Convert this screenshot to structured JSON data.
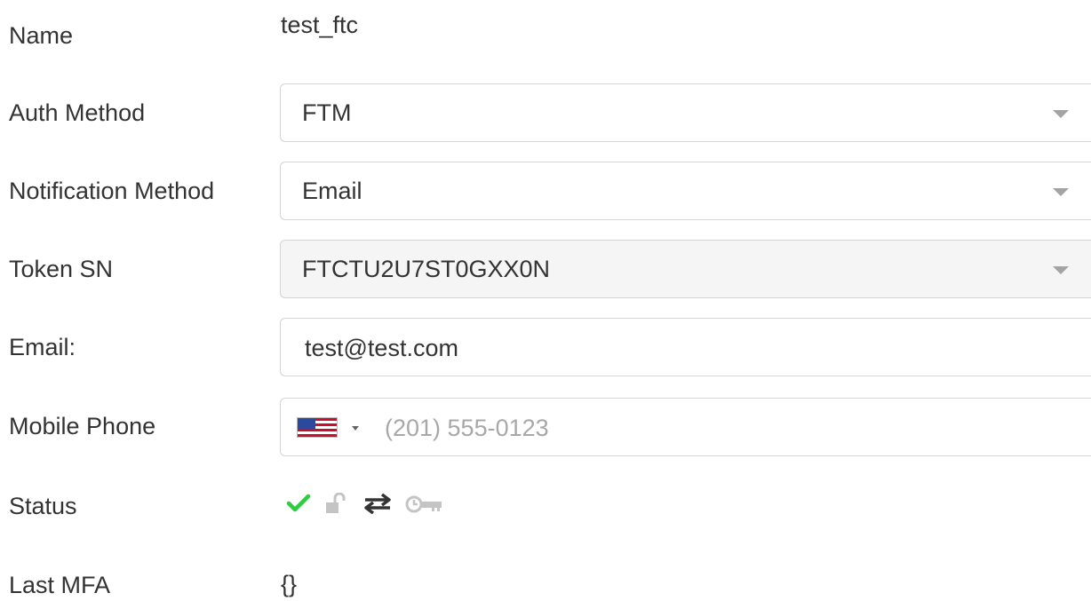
{
  "form": {
    "name": {
      "label": "Name",
      "value": "test_ftc"
    },
    "auth_method": {
      "label": "Auth Method",
      "value": "FTM"
    },
    "notification_method": {
      "label": "Notification Method",
      "value": "Email"
    },
    "token_sn": {
      "label": "Token SN",
      "value": "FTCTU2U7ST0GXX0N"
    },
    "email": {
      "label": "Email:",
      "value": "test@test.com"
    },
    "mobile_phone": {
      "label": "Mobile Phone",
      "country": "US",
      "placeholder": "(201) 555-0123"
    },
    "status": {
      "label": "Status",
      "icons": [
        "check-icon",
        "unlock-icon",
        "sync-arrows-icon",
        "clock-key-icon"
      ],
      "colors": {
        "active": "#2ecc40",
        "muted": "#c4c4c4",
        "dark": "#333333"
      }
    },
    "last_mfa": {
      "label": "Last MFA",
      "value": "{}"
    }
  }
}
